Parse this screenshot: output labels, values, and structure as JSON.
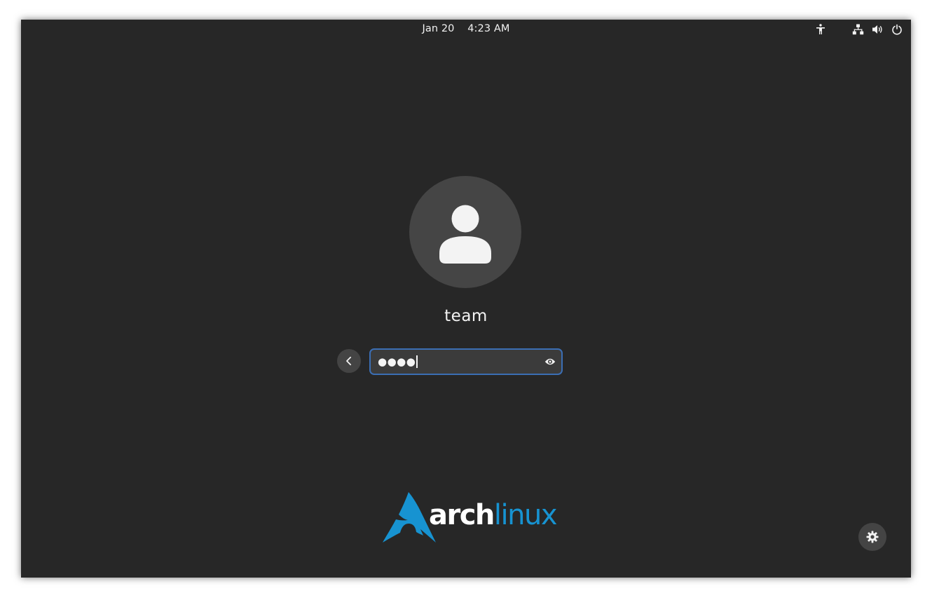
{
  "top_bar": {
    "date": "Jan 20",
    "time": "4:23 AM",
    "icons": [
      "accessibility-icon",
      "network-wired-icon",
      "volume-icon",
      "power-icon"
    ]
  },
  "login": {
    "username": "team",
    "password_masked": "●●●●",
    "password_length": 4
  },
  "branding": {
    "logo_word_bold": "arch",
    "logo_word_light": "linux",
    "logo_colors": {
      "brand_blue": "#1793d1",
      "white": "#ffffff"
    }
  },
  "colors": {
    "background": "#272727",
    "field_border_focus": "#3b6eb4",
    "button_bg": "#444444",
    "avatar_bg": "#454545"
  }
}
